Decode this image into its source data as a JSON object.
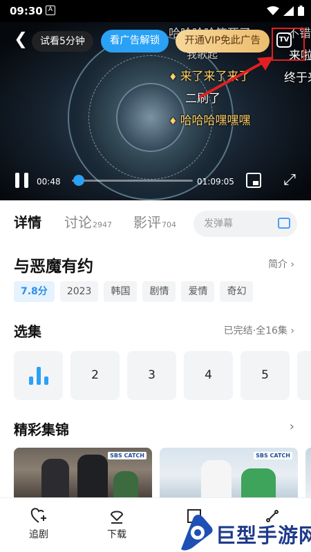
{
  "status": {
    "time": "09:30",
    "notif": "A"
  },
  "player": {
    "trial_label": "试看5分钟",
    "ad_unlock_label": "看广告解锁",
    "vip_label": "开通VIP免此广告",
    "tv_label": "TV",
    "current_time": "00:48",
    "duration": "01:09:05",
    "progress": 0.012,
    "danmaku": [
      {
        "text": "哈哈哈哈笑死了"
      },
      {
        "text": "不错"
      },
      {
        "text": "我歌起"
      },
      {
        "text": "来了来了来了"
      },
      {
        "text": "来啦"
      },
      {
        "text": "终于来"
      },
      {
        "text": "二刷了"
      },
      {
        "text": "哈哈哈嘿嘿嘿"
      }
    ]
  },
  "tabs": [
    {
      "label": "详情",
      "count": ""
    },
    {
      "label": "讨论",
      "count": "2947"
    },
    {
      "label": "影评",
      "count": "704"
    }
  ],
  "danmaku_input": {
    "placeholder": "发弹幕"
  },
  "show": {
    "title": "与恶魔有约",
    "intro_label": "简介",
    "tags": [
      "7.8分",
      "2023",
      "韩国",
      "剧情",
      "爱情",
      "奇幻"
    ]
  },
  "episodes": {
    "title": "选集",
    "status": "已完结·全16集",
    "items": [
      "2",
      "3",
      "4",
      "5"
    ]
  },
  "highlights": {
    "title": "精彩集锦",
    "badge1": "SBS CATCH",
    "badge2": "SBS CATCH"
  },
  "bottom_nav": [
    {
      "label": "追剧",
      "icon": "heart-plus-icon"
    },
    {
      "label": "下载",
      "icon": "download-icon"
    },
    {
      "label": "",
      "icon": "cast-icon"
    },
    {
      "label": "",
      "icon": "share-icon"
    }
  ],
  "watermark": "巨型手游网",
  "colors": {
    "accent": "#2aa1f5",
    "vip": "#ecbd6f",
    "red_highlight": "#e02020"
  }
}
